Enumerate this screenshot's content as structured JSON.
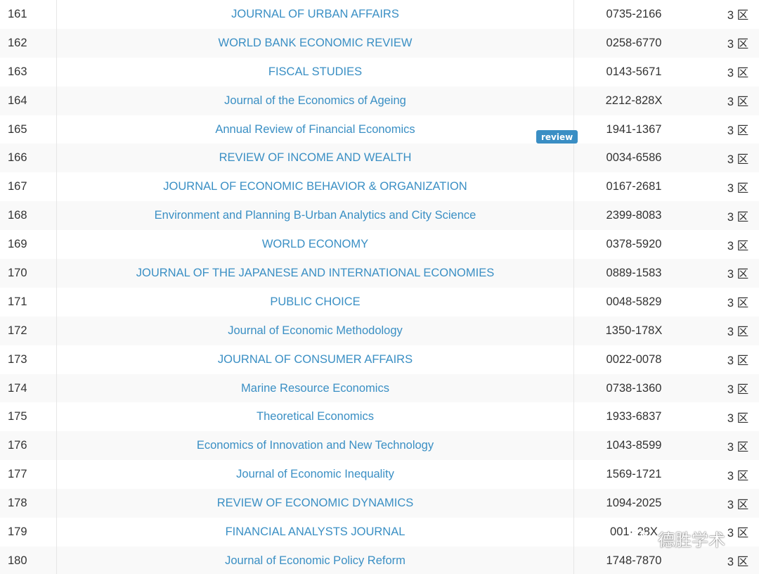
{
  "rows": [
    {
      "num": "161",
      "title": "JOURNAL OF URBAN AFFAIRS",
      "issn": "0735-2166",
      "zone": "3 区"
    },
    {
      "num": "162",
      "title": "WORLD BANK ECONOMIC REVIEW",
      "issn": "0258-6770",
      "zone": "3 区"
    },
    {
      "num": "163",
      "title": "FISCAL STUDIES",
      "issn": "0143-5671",
      "zone": "3 区"
    },
    {
      "num": "164",
      "title": "Journal of the Economics of Ageing",
      "issn": "2212-828X",
      "zone": "3 区"
    },
    {
      "num": "165",
      "title": "Annual Review of Financial Economics",
      "issn": "1941-1367",
      "zone": "3 区"
    },
    {
      "num": "166",
      "title": "REVIEW OF INCOME AND WEALTH",
      "issn": "0034-6586",
      "zone": "3 区"
    },
    {
      "num": "167",
      "title": "JOURNAL OF ECONOMIC BEHAVIOR & ORGANIZATION",
      "issn": "0167-2681",
      "zone": "3 区"
    },
    {
      "num": "168",
      "title": "Environment and Planning B-Urban Analytics and City Science",
      "issn": "2399-8083",
      "zone": "3 区"
    },
    {
      "num": "169",
      "title": "WORLD ECONOMY",
      "issn": "0378-5920",
      "zone": "3 区"
    },
    {
      "num": "170",
      "title": "JOURNAL OF THE JAPANESE AND INTERNATIONAL ECONOMIES",
      "issn": "0889-1583",
      "zone": "3 区"
    },
    {
      "num": "171",
      "title": "PUBLIC CHOICE",
      "issn": "0048-5829",
      "zone": "3 区"
    },
    {
      "num": "172",
      "title": "Journal of Economic Methodology",
      "issn": "1350-178X",
      "zone": "3 区"
    },
    {
      "num": "173",
      "title": "JOURNAL OF CONSUMER AFFAIRS",
      "issn": "0022-0078",
      "zone": "3 区"
    },
    {
      "num": "174",
      "title": "Marine Resource Economics",
      "issn": "0738-1360",
      "zone": "3 区"
    },
    {
      "num": "175",
      "title": "Theoretical Economics",
      "issn": "1933-6837",
      "zone": "3 区"
    },
    {
      "num": "176",
      "title": "Economics of Innovation and New Technology",
      "issn": "1043-8599",
      "zone": "3 区"
    },
    {
      "num": "177",
      "title": "Journal of Economic Inequality",
      "issn": "1569-1721",
      "zone": "3 区"
    },
    {
      "num": "178",
      "title": "REVIEW OF ECONOMIC DYNAMICS",
      "issn": "1094-2025",
      "zone": "3 区"
    },
    {
      "num": "179",
      "title": "FINANCIAL ANALYSTS JOURNAL",
      "issn": "001··28X",
      "zone": "3 区"
    },
    {
      "num": "180",
      "title": "Journal of Economic Policy Reform",
      "issn": "1748-7870",
      "zone": "3 区"
    }
  ],
  "badge": {
    "label": "review"
  },
  "watermark": {
    "text": "德胜学术",
    "icon": "wechat-icon"
  },
  "colors": {
    "link": "#3a8fc4",
    "text": "#333333",
    "stripe": "#f9f9f9",
    "badge": "#3a8ec4"
  }
}
